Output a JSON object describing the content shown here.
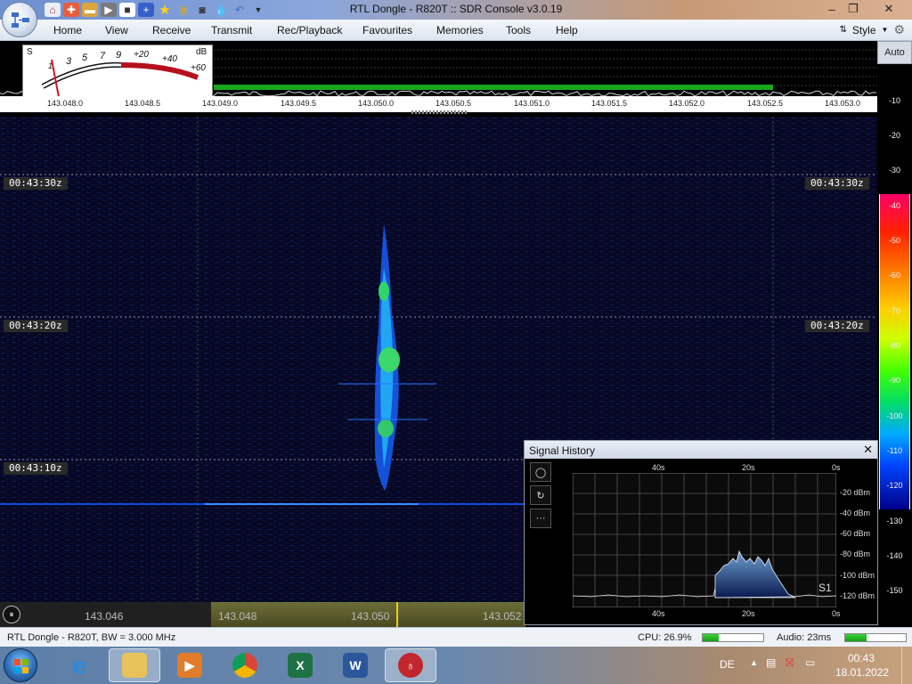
{
  "window": {
    "title": "RTL Dongle - R820T :: SDR Console v3.0.19",
    "minimize": "–",
    "maximize": "❐",
    "close": "✕"
  },
  "menu": {
    "items": [
      "Home",
      "View",
      "Receive",
      "Transmit",
      "Rec/Playback",
      "Favourites",
      "Memories",
      "Tools",
      "Help"
    ],
    "style_label": "Style"
  },
  "meter": {
    "s_label": "S",
    "db_label": "dB",
    "s_marks": [
      "1",
      "3",
      "5",
      "7",
      "9"
    ],
    "db_marks": [
      "+20",
      "+40",
      "+60"
    ]
  },
  "spectrum": {
    "freq_labels": [
      "143.048.0",
      "143.048.5",
      "143.049.0",
      "143.049.5",
      "143.050.0",
      "143.050.5",
      "143.051.0",
      "143.051.5",
      "143.052.0",
      "143.052.5",
      "143.053.0"
    ]
  },
  "waterfall": {
    "time_tags": [
      "00:43:30z",
      "00:43:20z",
      "00:43:10z"
    ]
  },
  "colorbar": {
    "auto_label": "Auto",
    "db_scale": [
      "-10",
      "-20",
      "-30",
      "-40",
      "-50",
      "-60",
      "-70",
      "-80",
      "-90",
      "-100",
      "-110",
      "-120",
      "-130",
      "-140",
      "-150"
    ]
  },
  "tuner": {
    "labels": [
      "143.046",
      "143.048",
      "143.050",
      "143.052"
    ]
  },
  "signal_history": {
    "title": "Signal History",
    "close": "✕",
    "time_ticks": [
      "40s",
      "20s",
      "0s"
    ],
    "level_ticks": [
      "-20 dBm",
      "-40 dBm",
      "-60 dBm",
      "-80 dBm",
      "-100 dBm",
      "-120 dBm"
    ],
    "s_reading": "S1",
    "tools": [
      "◯",
      "↻",
      "···"
    ]
  },
  "status": {
    "device": "RTL Dongle - R820T, BW = 3.000 MHz",
    "cpu": "CPU: 26.9%",
    "cpu_fraction": 0.27,
    "audio": "Audio: 23ms",
    "audio_fraction": 0.35
  },
  "taskbar": {
    "apps": [
      "Internet Explorer",
      "File Explorer",
      "Media Player",
      "Chrome",
      "Excel",
      "Word",
      "SDR Console"
    ],
    "language": "DE",
    "time": "00:43",
    "date": "18.01.2022"
  },
  "colors": {
    "waterfall_bg": "#050620",
    "signal_blue": "#1f6bff",
    "signal_green": "#3ad86a",
    "titlebar_blue": "#7895d6",
    "cpu_bar": "#22b822"
  }
}
